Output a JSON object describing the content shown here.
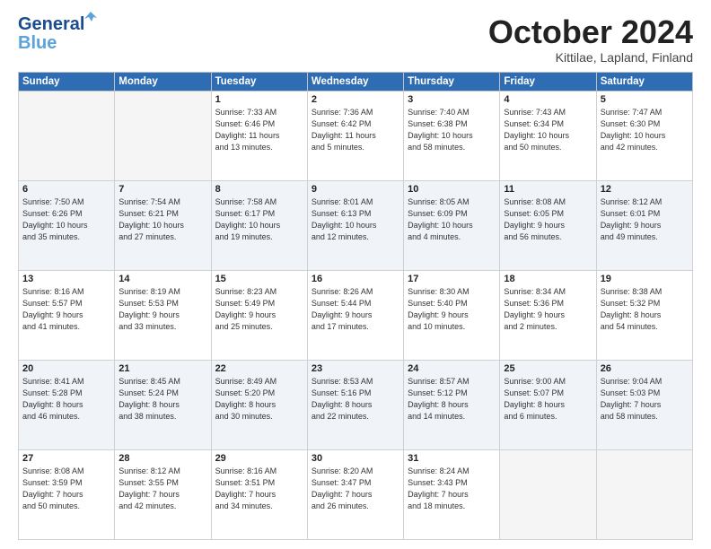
{
  "header": {
    "logo_line1": "General",
    "logo_line2": "Blue",
    "month": "October 2024",
    "location": "Kittilae, Lapland, Finland"
  },
  "weekdays": [
    "Sunday",
    "Monday",
    "Tuesday",
    "Wednesday",
    "Thursday",
    "Friday",
    "Saturday"
  ],
  "weeks": [
    [
      {
        "day": "",
        "info": ""
      },
      {
        "day": "",
        "info": ""
      },
      {
        "day": "1",
        "info": "Sunrise: 7:33 AM\nSunset: 6:46 PM\nDaylight: 11 hours\nand 13 minutes."
      },
      {
        "day": "2",
        "info": "Sunrise: 7:36 AM\nSunset: 6:42 PM\nDaylight: 11 hours\nand 5 minutes."
      },
      {
        "day": "3",
        "info": "Sunrise: 7:40 AM\nSunset: 6:38 PM\nDaylight: 10 hours\nand 58 minutes."
      },
      {
        "day": "4",
        "info": "Sunrise: 7:43 AM\nSunset: 6:34 PM\nDaylight: 10 hours\nand 50 minutes."
      },
      {
        "day": "5",
        "info": "Sunrise: 7:47 AM\nSunset: 6:30 PM\nDaylight: 10 hours\nand 42 minutes."
      }
    ],
    [
      {
        "day": "6",
        "info": "Sunrise: 7:50 AM\nSunset: 6:26 PM\nDaylight: 10 hours\nand 35 minutes."
      },
      {
        "day": "7",
        "info": "Sunrise: 7:54 AM\nSunset: 6:21 PM\nDaylight: 10 hours\nand 27 minutes."
      },
      {
        "day": "8",
        "info": "Sunrise: 7:58 AM\nSunset: 6:17 PM\nDaylight: 10 hours\nand 19 minutes."
      },
      {
        "day": "9",
        "info": "Sunrise: 8:01 AM\nSunset: 6:13 PM\nDaylight: 10 hours\nand 12 minutes."
      },
      {
        "day": "10",
        "info": "Sunrise: 8:05 AM\nSunset: 6:09 PM\nDaylight: 10 hours\nand 4 minutes."
      },
      {
        "day": "11",
        "info": "Sunrise: 8:08 AM\nSunset: 6:05 PM\nDaylight: 9 hours\nand 56 minutes."
      },
      {
        "day": "12",
        "info": "Sunrise: 8:12 AM\nSunset: 6:01 PM\nDaylight: 9 hours\nand 49 minutes."
      }
    ],
    [
      {
        "day": "13",
        "info": "Sunrise: 8:16 AM\nSunset: 5:57 PM\nDaylight: 9 hours\nand 41 minutes."
      },
      {
        "day": "14",
        "info": "Sunrise: 8:19 AM\nSunset: 5:53 PM\nDaylight: 9 hours\nand 33 minutes."
      },
      {
        "day": "15",
        "info": "Sunrise: 8:23 AM\nSunset: 5:49 PM\nDaylight: 9 hours\nand 25 minutes."
      },
      {
        "day": "16",
        "info": "Sunrise: 8:26 AM\nSunset: 5:44 PM\nDaylight: 9 hours\nand 17 minutes."
      },
      {
        "day": "17",
        "info": "Sunrise: 8:30 AM\nSunset: 5:40 PM\nDaylight: 9 hours\nand 10 minutes."
      },
      {
        "day": "18",
        "info": "Sunrise: 8:34 AM\nSunset: 5:36 PM\nDaylight: 9 hours\nand 2 minutes."
      },
      {
        "day": "19",
        "info": "Sunrise: 8:38 AM\nSunset: 5:32 PM\nDaylight: 8 hours\nand 54 minutes."
      }
    ],
    [
      {
        "day": "20",
        "info": "Sunrise: 8:41 AM\nSunset: 5:28 PM\nDaylight: 8 hours\nand 46 minutes."
      },
      {
        "day": "21",
        "info": "Sunrise: 8:45 AM\nSunset: 5:24 PM\nDaylight: 8 hours\nand 38 minutes."
      },
      {
        "day": "22",
        "info": "Sunrise: 8:49 AM\nSunset: 5:20 PM\nDaylight: 8 hours\nand 30 minutes."
      },
      {
        "day": "23",
        "info": "Sunrise: 8:53 AM\nSunset: 5:16 PM\nDaylight: 8 hours\nand 22 minutes."
      },
      {
        "day": "24",
        "info": "Sunrise: 8:57 AM\nSunset: 5:12 PM\nDaylight: 8 hours\nand 14 minutes."
      },
      {
        "day": "25",
        "info": "Sunrise: 9:00 AM\nSunset: 5:07 PM\nDaylight: 8 hours\nand 6 minutes."
      },
      {
        "day": "26",
        "info": "Sunrise: 9:04 AM\nSunset: 5:03 PM\nDaylight: 7 hours\nand 58 minutes."
      }
    ],
    [
      {
        "day": "27",
        "info": "Sunrise: 8:08 AM\nSunset: 3:59 PM\nDaylight: 7 hours\nand 50 minutes."
      },
      {
        "day": "28",
        "info": "Sunrise: 8:12 AM\nSunset: 3:55 PM\nDaylight: 7 hours\nand 42 minutes."
      },
      {
        "day": "29",
        "info": "Sunrise: 8:16 AM\nSunset: 3:51 PM\nDaylight: 7 hours\nand 34 minutes."
      },
      {
        "day": "30",
        "info": "Sunrise: 8:20 AM\nSunset: 3:47 PM\nDaylight: 7 hours\nand 26 minutes."
      },
      {
        "day": "31",
        "info": "Sunrise: 8:24 AM\nSunset: 3:43 PM\nDaylight: 7 hours\nand 18 minutes."
      },
      {
        "day": "",
        "info": ""
      },
      {
        "day": "",
        "info": ""
      }
    ]
  ]
}
